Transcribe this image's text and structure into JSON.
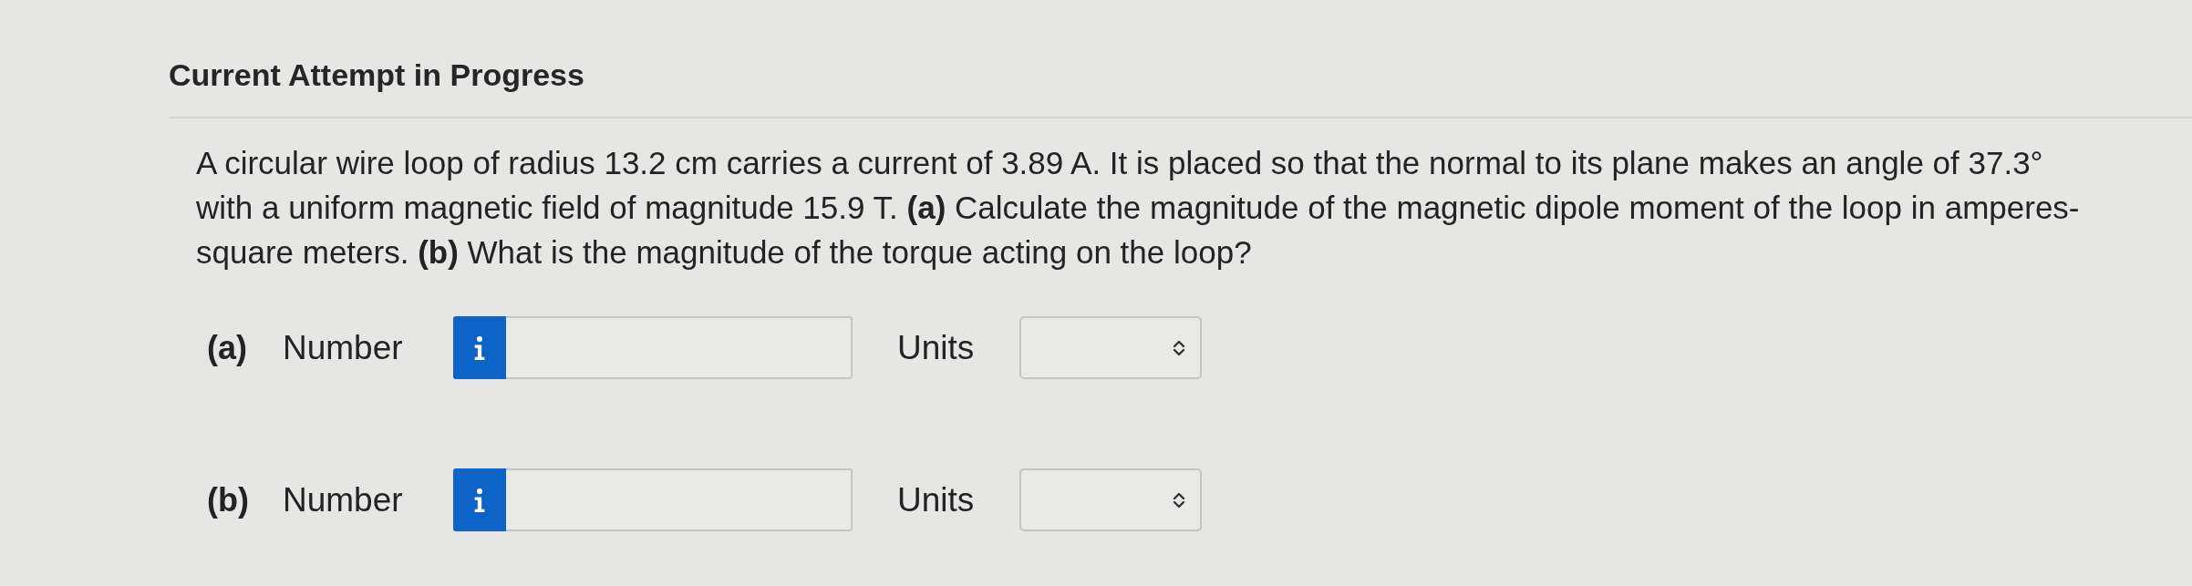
{
  "section": {
    "title": "Current Attempt in Progress"
  },
  "question": {
    "text": "A circular wire loop of radius 13.2 cm carries a current of 3.89 A. It is placed so that the normal to its plane makes an angle of 37.3° with a uniform magnetic field of magnitude 15.9 T. **(a)** Calculate the magnitude of the magnetic dipole moment of the loop in amperes-square meters. **(b)** What is the magnitude of the torque acting on the loop?"
  },
  "answers": [
    {
      "part": "(a)",
      "label": "Number",
      "units_label": "Units"
    },
    {
      "part": "(b)",
      "label": "Number",
      "units_label": "Units"
    }
  ]
}
